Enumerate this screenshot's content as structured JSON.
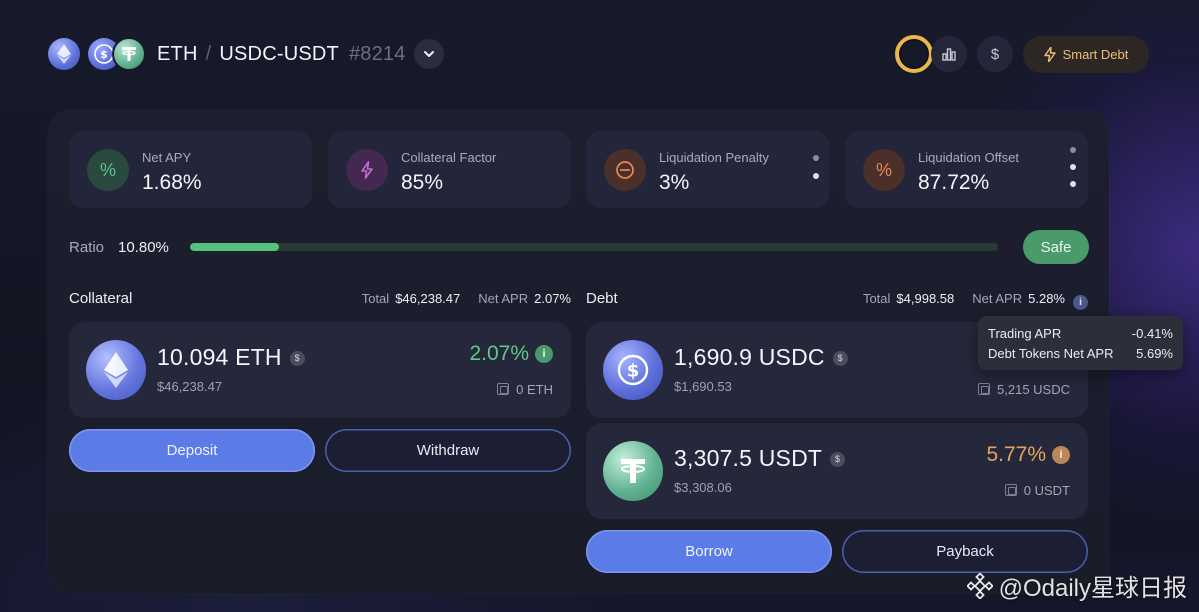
{
  "header": {
    "base_token": "ETH",
    "separator": "/",
    "debt_pair": "USDC-USDT",
    "position_id": "#8214",
    "smart_debt_label": "Smart Debt"
  },
  "stats": [
    {
      "label": "Net APY",
      "value": "1.68%",
      "icon": "percent-icon",
      "color": "#5fc08d"
    },
    {
      "label": "Collateral Factor",
      "value": "85%",
      "icon": "lightning-icon",
      "color": "#c46bd6"
    },
    {
      "label": "Liquidation Penalty",
      "value": "3%",
      "icon": "minus-circle-icon",
      "color": "#e8885a"
    },
    {
      "label": "Liquidation Offset",
      "value": "87.72%",
      "icon": "percent-icon",
      "color": "#e8885a"
    }
  ],
  "ratio": {
    "label": "Ratio",
    "value": "10.80%",
    "fill_fraction": 0.11,
    "status": "Safe"
  },
  "collateral": {
    "title": "Collateral",
    "total_label": "Total",
    "total_value": "$46,238.47",
    "apr_label": "Net APR",
    "apr_value": "2.07%",
    "asset": {
      "amount": "10.094 ETH",
      "usd": "$46,238.47",
      "rate": "2.07%",
      "pool": "0 ETH"
    },
    "deposit_label": "Deposit",
    "withdraw_label": "Withdraw"
  },
  "debt": {
    "title": "Debt",
    "total_label": "Total",
    "total_value": "$4,998.58",
    "apr_label": "Net APR",
    "apr_value": "5.28%",
    "assets": [
      {
        "amount": "1,690.9 USDC",
        "usd": "$1,690.53",
        "pool": "5,215 USDC"
      },
      {
        "amount": "3,307.5 USDT",
        "usd": "$3,308.06",
        "rate": "5.77%",
        "pool": "0 USDT"
      }
    ],
    "borrow_label": "Borrow",
    "payback_label": "Payback"
  },
  "tooltip": {
    "rows": [
      {
        "label": "Trading APR",
        "value": "-0.41%"
      },
      {
        "label": "Debt Tokens Net APR",
        "value": "5.69%"
      }
    ]
  },
  "watermark": "@Odaily星球日报",
  "colors": {
    "accent": "#5b7be6",
    "safe": "#4a9a6b",
    "positive_rate": "#5fc98a",
    "debt_rate": "#e3a463",
    "smart_debt": "#efbf7b"
  }
}
